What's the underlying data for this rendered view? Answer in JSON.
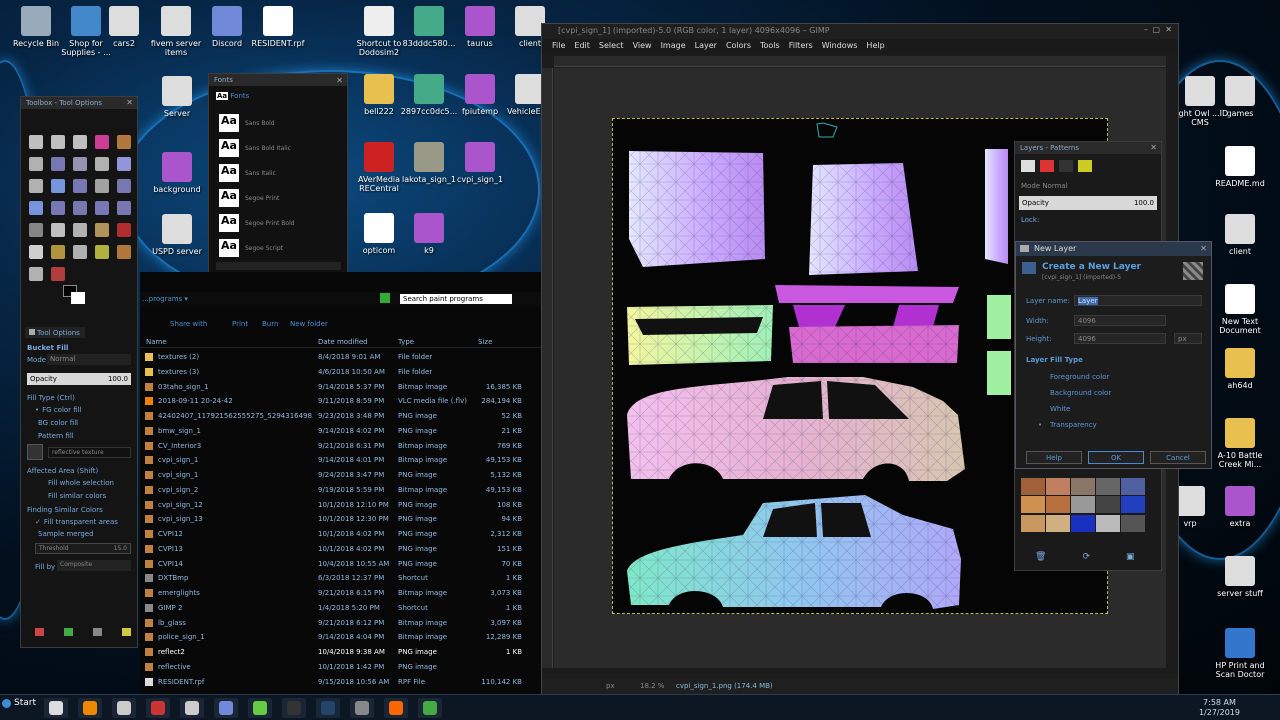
{
  "colors": {
    "accent": "#3a8fd8",
    "gimp_bg": "#1c1c1c",
    "selection": "#bcbc40"
  },
  "desktop_left_icons": [
    {
      "label": "Recycle Bin",
      "icon": "recycle-bin-icon"
    },
    {
      "label": "Shop for Supplies - ...",
      "icon": "printer-icon"
    },
    {
      "label": "cars2",
      "icon": "document-icon"
    },
    {
      "label": "fivem server items",
      "icon": "document-icon"
    },
    {
      "label": "Discord",
      "icon": "discord-icon"
    },
    {
      "label": "RESIDENT.rpf",
      "icon": "file-icon"
    },
    {
      "label": "Shortcut to Dodosim2",
      "icon": "shortcut-icon"
    },
    {
      "label": "83dddc580...",
      "icon": "medical-icon"
    },
    {
      "label": "taurus",
      "icon": "image-icon"
    },
    {
      "label": "client",
      "icon": "document-icon"
    }
  ],
  "desktop_mid_icons": [
    {
      "label": "Server",
      "icon": "document-icon"
    },
    {
      "label": "background",
      "icon": "image-icon"
    },
    {
      "label": "USPD server",
      "icon": "document-icon"
    },
    {
      "label": "bell222",
      "icon": "folder-icon"
    },
    {
      "label": "2897cc0dc5...",
      "icon": "medical-icon"
    },
    {
      "label": "fpiutemp",
      "icon": "image-icon"
    },
    {
      "label": "VehicleEx...",
      "icon": "document-icon"
    },
    {
      "label": "AVerMedia RECentral",
      "icon": "avermedia-icon"
    },
    {
      "label": "lakota_sign_1",
      "icon": "gimp-icon"
    },
    {
      "label": "cvpi_sign_1",
      "icon": "image-icon"
    },
    {
      "label": "opticom",
      "icon": "file-icon"
    },
    {
      "label": "k9",
      "icon": "image-icon"
    }
  ],
  "desktop_right_icons": [
    {
      "label": "games",
      "icon": "document-icon"
    },
    {
      "label": "Light Owl ...ID CMS",
      "icon": "document-icon"
    },
    {
      "label": "README.md",
      "icon": "file-icon"
    },
    {
      "label": "client",
      "icon": "document-icon"
    },
    {
      "label": "New Text Document",
      "icon": "file-icon"
    },
    {
      "label": "ah64d",
      "icon": "folder-icon"
    },
    {
      "label": "A-10 Battle Creek Mi...",
      "icon": "folder-icon"
    },
    {
      "label": "extra",
      "icon": "image-icon"
    },
    {
      "label": "vrp",
      "icon": "document-icon"
    },
    {
      "label": "server stuff",
      "icon": "document-icon"
    },
    {
      "label": "HP Print and Scan Doctor",
      "icon": "hp-icon"
    }
  ],
  "toolbox": {
    "title": "Toolbox - Tool Options",
    "tool_options_tab": "Tool Options",
    "tool_name": "Bucket Fill",
    "mode_label": "Mode",
    "mode_value": "Normal",
    "opacity_label": "Opacity",
    "opacity_value": "100.0",
    "fill_type_label": "Fill Type  (Ctrl)",
    "fill_types": [
      "FG color fill",
      "BG color fill",
      "Pattern fill"
    ],
    "pattern_name": "reflective texture",
    "affected_label": "Affected Area  (Shift)",
    "affected_options": [
      "Fill whole selection",
      "Fill similar colors"
    ],
    "finding_label": "Finding Similar Colors",
    "finding_options": [
      "Fill transparent areas",
      "Sample merged"
    ],
    "threshold_label": "Threshold",
    "threshold_value": "15.0",
    "fill_by_label": "Fill by",
    "fill_by_value": "Composite"
  },
  "fonts_panel": {
    "title": "Fonts",
    "tab": "Fonts",
    "fonts": [
      "Sans Bold",
      "Sans Bold Italic",
      "Sans Italic",
      "Segoe Print",
      "Segoe Print Bold",
      "Segoe Script"
    ]
  },
  "gimp": {
    "title": "[cvpi_sign_1] (imported)-5.0 (RGB color, 1 layer) 4096x4096 – GIMP",
    "menu": [
      "File",
      "Edit",
      "Select",
      "View",
      "Image",
      "Layer",
      "Colors",
      "Tools",
      "Filters",
      "Windows",
      "Help"
    ],
    "status_unit": "px",
    "status_zoom": "18.2 %",
    "status_file": "cvpi_sign_1.png (174.4 MB)"
  },
  "layers_panel": {
    "title": "Layers - Patterns",
    "mode_label": "Mode",
    "mode_value": "Normal",
    "opacity_label": "Opacity",
    "opacity_value": "100.0",
    "lock_label": "Lock:"
  },
  "new_layer_dialog": {
    "title": "New Layer",
    "heading": "Create a New Layer",
    "subheading": "[cvpi_sign_1] (imported)-5",
    "layer_name_label": "Layer name:",
    "layer_name_value": "Layer",
    "width_label": "Width:",
    "width_value": "4096",
    "height_label": "Height:",
    "height_value": "4096",
    "unit": "px",
    "fill_type_label": "Layer Fill Type",
    "fill_options": [
      "Foreground color",
      "Background color",
      "White",
      "Transparency"
    ],
    "selected_fill": "Transparency",
    "help_btn": "Help",
    "ok_btn": "OK",
    "cancel_btn": "Cancel"
  },
  "explorer": {
    "location": "...programs",
    "search_placeholder": "Search paint programs",
    "toolbar": [
      "Share with",
      "Print",
      "Burn",
      "New folder"
    ],
    "columns": [
      "Name",
      "Date modified",
      "Type",
      "Size"
    ],
    "files": [
      {
        "name": "textures (2)",
        "date": "8/4/2018 9:01 AM",
        "type": "File folder",
        "size": "",
        "icon": "folder"
      },
      {
        "name": "textures (3)",
        "date": "4/6/2018 10:50 AM",
        "type": "File folder",
        "size": "",
        "icon": "folder"
      },
      {
        "name": "03taho_sign_1",
        "date": "9/14/2018 5:37 PM",
        "type": "Bitmap image",
        "size": "16,385 KB",
        "icon": "image"
      },
      {
        "name": "2018-09-11 20-24-42",
        "date": "9/11/2018 8:59 PM",
        "type": "VLC media file (.flv)",
        "size": "284,194 KB",
        "icon": "vlc"
      },
      {
        "name": "42402407_117921562555275_5294316498...",
        "date": "9/23/2018 3:48 PM",
        "type": "PNG image",
        "size": "52 KB",
        "icon": "image"
      },
      {
        "name": "bmw_sign_1",
        "date": "9/14/2018 4:02 PM",
        "type": "PNG image",
        "size": "21 KB",
        "icon": "image"
      },
      {
        "name": "CV_Interior3",
        "date": "9/21/2018 6:31 PM",
        "type": "Bitmap image",
        "size": "769 KB",
        "icon": "image"
      },
      {
        "name": "cvpi_sign_1",
        "date": "9/14/2018 4:01 PM",
        "type": "Bitmap image",
        "size": "49,153 KB",
        "icon": "image"
      },
      {
        "name": "cvpi_sign_1",
        "date": "9/24/2018 3:47 PM",
        "type": "PNG image",
        "size": "5,132 KB",
        "icon": "image"
      },
      {
        "name": "cvpi_sign_2",
        "date": "9/19/2018 5:59 PM",
        "type": "Bitmap image",
        "size": "49,153 KB",
        "icon": "image"
      },
      {
        "name": "cvpi_sign_12",
        "date": "10/1/2018 12:10 PM",
        "type": "PNG image",
        "size": "108 KB",
        "icon": "image"
      },
      {
        "name": "cvpi_sign_13",
        "date": "10/1/2018 12:30 PM",
        "type": "PNG image",
        "size": "94 KB",
        "icon": "image"
      },
      {
        "name": "CVPI12",
        "date": "10/1/2018 4:02 PM",
        "type": "PNG image",
        "size": "2,312 KB",
        "icon": "image"
      },
      {
        "name": "CVPI13",
        "date": "10/1/2018 4:02 PM",
        "type": "PNG image",
        "size": "151 KB",
        "icon": "image"
      },
      {
        "name": "CVPI14",
        "date": "10/4/2018 10:55 AM",
        "type": "PNG image",
        "size": "70 KB",
        "icon": "image"
      },
      {
        "name": "DXTBmp",
        "date": "6/3/2018 12:37 PM",
        "type": "Shortcut",
        "size": "1 KB",
        "icon": "shortcut"
      },
      {
        "name": "emerglights",
        "date": "9/21/2018 6:15 PM",
        "type": "Bitmap image",
        "size": "3,073 KB",
        "icon": "image"
      },
      {
        "name": "GIMP 2",
        "date": "1/4/2018 5:20 PM",
        "type": "Shortcut",
        "size": "1 KB",
        "icon": "shortcut"
      },
      {
        "name": "lb_glass",
        "date": "9/21/2018 6:12 PM",
        "type": "Bitmap image",
        "size": "3,097 KB",
        "icon": "image"
      },
      {
        "name": "police_sign_1",
        "date": "9/14/2018 4:04 PM",
        "type": "Bitmap image",
        "size": "12,289 KB",
        "icon": "image"
      },
      {
        "name": "reflect2",
        "date": "10/4/2018 9:38 AM",
        "type": "PNG image",
        "size": "1 KB",
        "icon": "image"
      },
      {
        "name": "reflective",
        "date": "10/1/2018 1:42 PM",
        "type": "PNG image",
        "size": "",
        "icon": "image"
      },
      {
        "name": "RESIDENT.rpf",
        "date": "9/15/2018 10:56 AM",
        "type": "RPF File",
        "size": "110,142 KB",
        "icon": "file"
      }
    ]
  },
  "taskbar": {
    "start": "Start",
    "time": "7:58 AM",
    "date": "1/27/2019"
  }
}
